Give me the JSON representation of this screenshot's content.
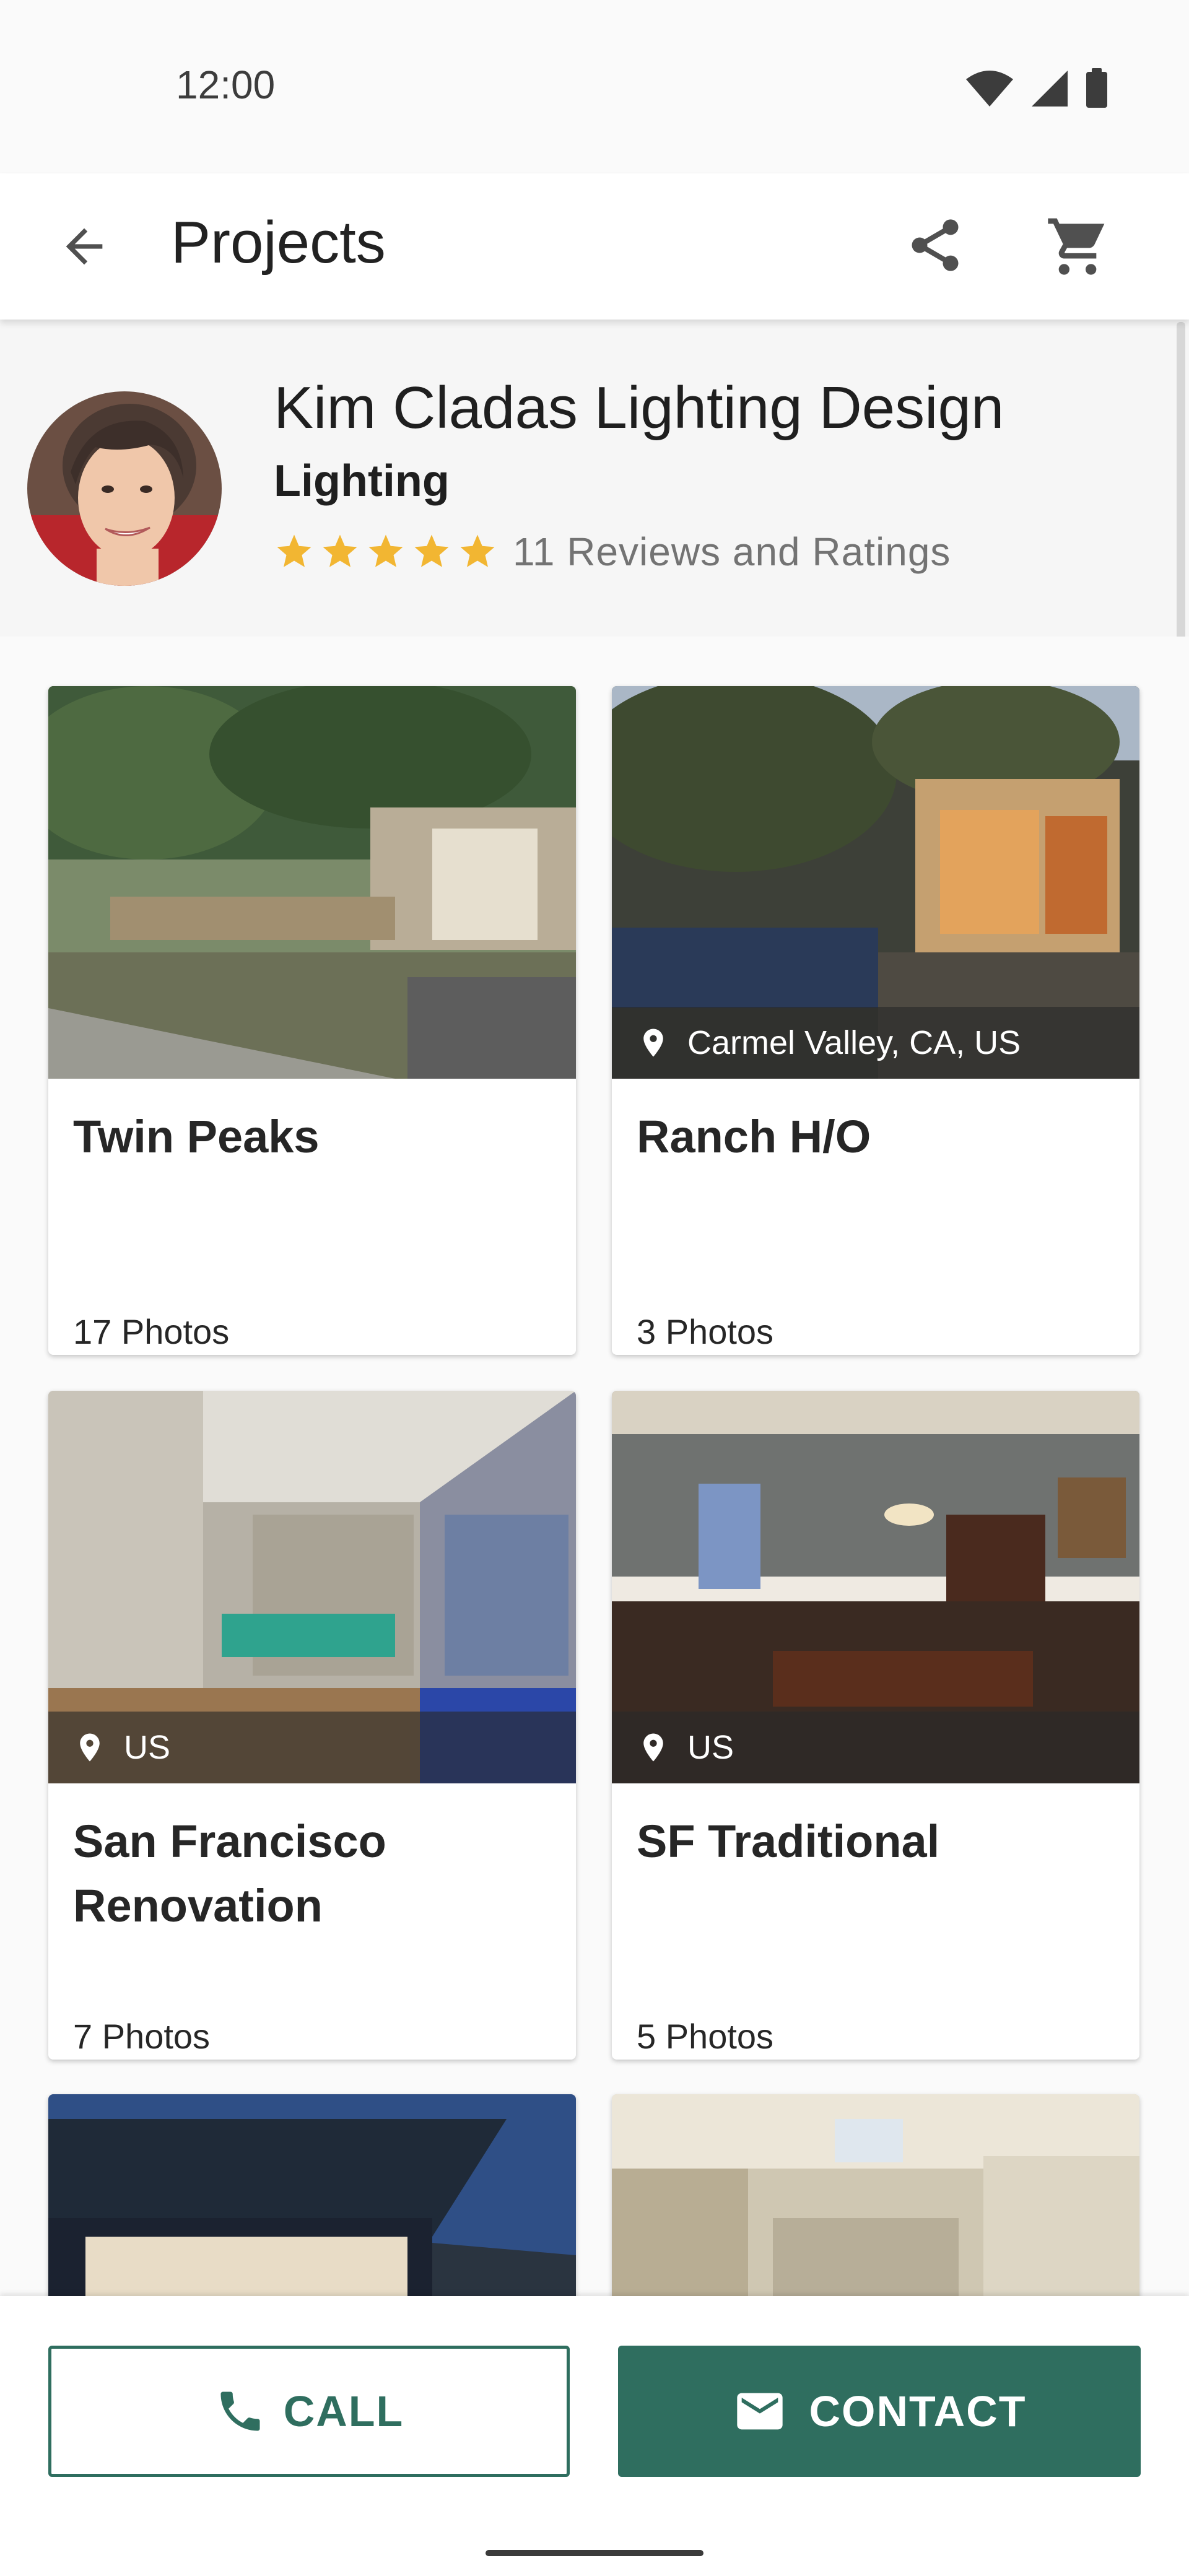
{
  "status_bar": {
    "time": "12:00"
  },
  "app_bar": {
    "title": "Projects"
  },
  "profile": {
    "name": "Kim Cladas Lighting Design",
    "category": "Lighting",
    "rating": 5,
    "reviews_text": "11 Reviews and Ratings"
  },
  "projects": [
    {
      "title": "Twin Peaks",
      "photos": "17 Photos",
      "location": ""
    },
    {
      "title": "Ranch H/O",
      "photos": "3 Photos",
      "location": "Carmel Valley, CA, US"
    },
    {
      "title": "San Francisco Renovation",
      "photos": "7 Photos",
      "location": "US"
    },
    {
      "title": "SF Traditional",
      "photos": "5 Photos",
      "location": "US"
    }
  ],
  "actions": {
    "call_label": "CALL",
    "contact_label": "CONTACT"
  },
  "colors": {
    "accent": "#2f6e5f",
    "star": "#f2b632",
    "background": "#fafafa"
  },
  "icons": [
    "back-arrow-icon",
    "share-icon",
    "cart-icon",
    "star-icon",
    "location-pin-icon",
    "phone-icon",
    "mail-icon"
  ]
}
